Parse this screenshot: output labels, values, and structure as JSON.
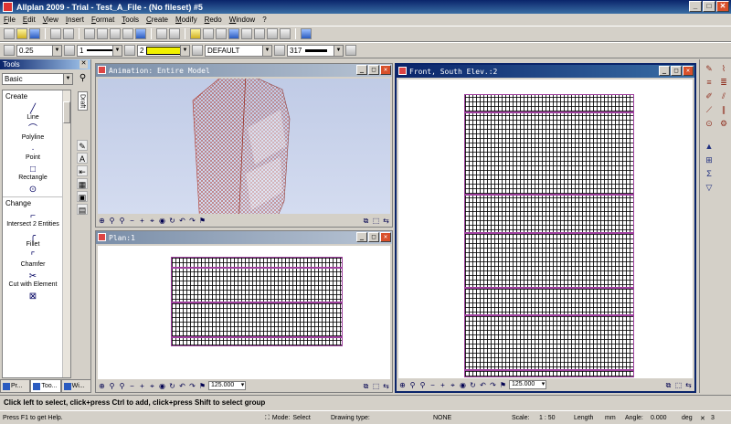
{
  "window": {
    "title": "Allplan 2009 - Trial - Test_A_File - (No fileset) #5"
  },
  "menu": [
    "File",
    "Edit",
    "View",
    "Insert",
    "Format",
    "Tools",
    "Create",
    "Modify",
    "Redo",
    "Window",
    "?"
  ],
  "toolbar2": {
    "pen": "0.25",
    "line": "1",
    "color_number": "2",
    "color_swatch": "#f0f000",
    "layer": "DEFAULT",
    "pattern_number": "317"
  },
  "tools_panel": {
    "title": "Tools",
    "palette": "Basic",
    "draft_tab": "Draft",
    "groups": [
      {
        "label": "Create",
        "items": [
          "Line",
          "Polyline",
          "Point",
          "Rectangle"
        ]
      },
      {
        "label": "Change",
        "items": [
          "Intersect 2 Entities",
          "Fillet",
          "Chamfer",
          "Cut with Element"
        ]
      }
    ],
    "tabs": [
      "Pr...",
      "Too...",
      "Wi..."
    ]
  },
  "viewports": [
    {
      "title": "Animation: Entire Model",
      "active": false
    },
    {
      "title": "Plan:1",
      "active": false,
      "scale": "125.000"
    },
    {
      "title": "Front, South Elev.:2",
      "active": true,
      "scale": "125.000"
    }
  ],
  "prompt": "Click left to select, click+press Ctrl to add, click+press Shift to select group",
  "status": {
    "help": "Press F1 to get Help.",
    "mode_label": "Mode:",
    "mode_value": "Select",
    "drawing_type_label": "Drawing type:",
    "drawing_type_value": "NONE",
    "scale_label": "Scale:",
    "scale_value": "1 : 50",
    "length_label": "Length",
    "length_unit": "mm",
    "angle_label": "Angle:",
    "angle_value": "0.000",
    "angle_unit": "deg",
    "trailing": "3"
  }
}
